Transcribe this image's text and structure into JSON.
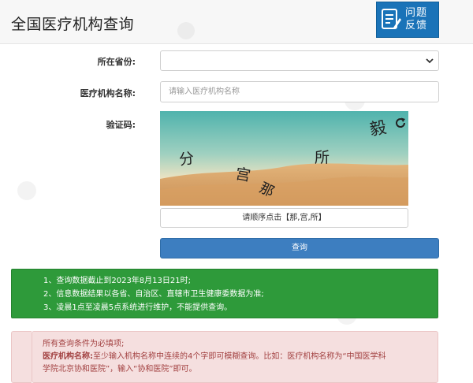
{
  "header": {
    "title": "全国医疗机构查询",
    "feedback_line1": "问题",
    "feedback_line2": "反馈"
  },
  "form": {
    "province_label": "所在省份:",
    "province_value": "",
    "name_label": "医疗机构名称:",
    "name_placeholder": "请输入医疗机构名称",
    "captcha_label": "验证码:",
    "captcha_chars": [
      "分",
      "宫",
      "那",
      "所",
      "毅"
    ],
    "captcha_hint": "请顺序点击【那,宫,所】",
    "submit_label": "查询"
  },
  "notice": {
    "lines": [
      "1、查询数据截止到2023年8月13日21时;",
      "2、信息数据结果以各省、自治区、直辖市卫生健康委数据为准;",
      "3、凌晨1点至凌晨5点系统进行维护，不能提供查询。"
    ],
    "background": "#2e9a3a"
  },
  "tips": {
    "line1": "所有查询条件为必填项;",
    "name_bold": "医疗机构名称:",
    "name_text": "至少输入机构名称中连续的4个字即可模糊查询。比如：医疗机构名称为“中国医学科",
    "line3": "学院北京协和医院”，输入“协和医院”即可。"
  },
  "colors": {
    "button": "#3d7ec0",
    "feedback": "#1a73b8",
    "tips_text": "#a24141"
  }
}
